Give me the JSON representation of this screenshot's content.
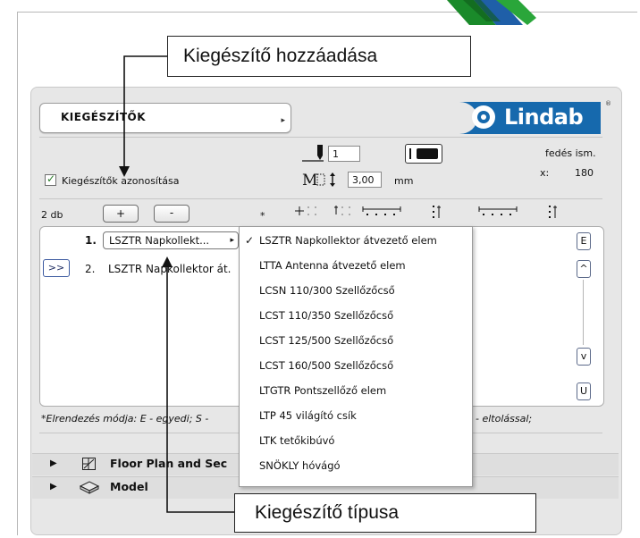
{
  "callouts": {
    "top": "Kiegészítő hozzáadása",
    "bottom": "Kiegészítő típusa"
  },
  "header": {
    "dropdown_label": "KIEGÉSZÍTŐK",
    "logo_text": "Lindab",
    "logo_mark": "®"
  },
  "controls": {
    "checkbox_label": "Kiegészítők azonosítása",
    "pen_value": "1",
    "height_value": "3,00",
    "height_unit": "mm",
    "fedes_label": "fedés ism.",
    "x_label": "x:",
    "x_value": "180",
    "m_symbol": "M"
  },
  "list_header": {
    "count": "2 db",
    "add_label": "+",
    "remove_label": "-",
    "star": "*"
  },
  "list": {
    "items": [
      {
        "num": "1.",
        "dropdown": "LSZTR Napkollekt...",
        "text": ""
      },
      {
        "num": "2.",
        "dropdown": "",
        "text": "LSZTR Napkollektor át."
      }
    ],
    "move_button": ">>",
    "side_buttons": {
      "e": "E",
      "up": "^",
      "down": "v",
      "u": "U"
    }
  },
  "footnote": {
    "left": "*Elrendezés módja: E - egyedi; S -",
    "right": "- eltolással;"
  },
  "menu": {
    "items": [
      {
        "label": "LSZTR Napkollektor átvezető elem",
        "checked": true
      },
      {
        "label": "LTTA Antenna átvezető elem",
        "checked": false
      },
      {
        "label": "LCSN 110/300 Szellőzőcső",
        "checked": false
      },
      {
        "label": "LCST 110/350 Szellőzőcső",
        "checked": false
      },
      {
        "label": "LCST 125/500 Szellőzőcső",
        "checked": false
      },
      {
        "label": "LCST 160/500 Szellőzőcső",
        "checked": false
      },
      {
        "label": "LTGTR Pontszellőző elem",
        "checked": false
      },
      {
        "label": "LTP 45 világító csík",
        "checked": false
      },
      {
        "label": "LTK tetőkibúvó",
        "checked": false
      },
      {
        "label": "SNÖKLY hóvágó",
        "checked": false
      }
    ],
    "check_glyph": "✓"
  },
  "tree": {
    "floor_plan": "Floor Plan and Sec",
    "model": "Model"
  }
}
